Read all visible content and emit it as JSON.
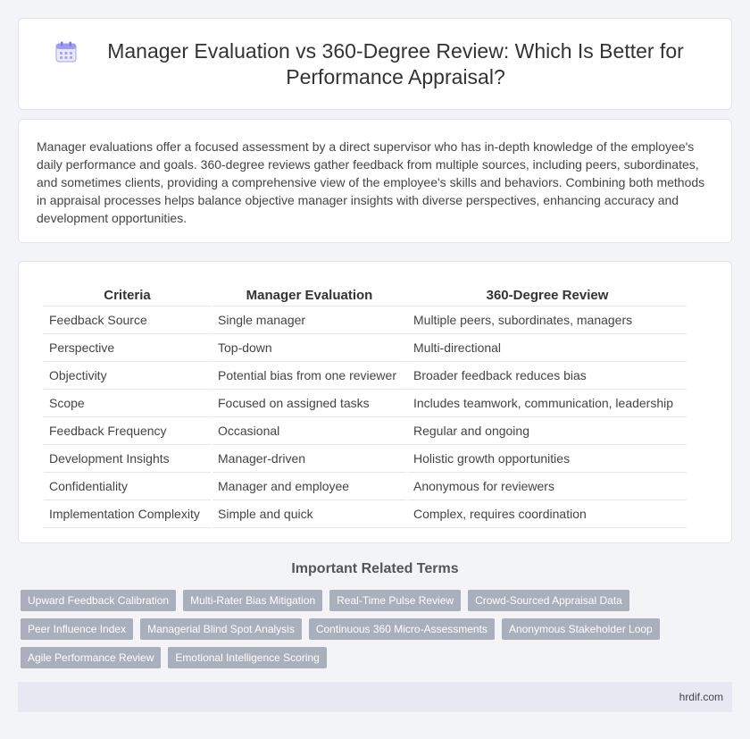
{
  "header": {
    "title": "Manager Evaluation vs 360-Degree Review: Which Is Better for Performance Appraisal?",
    "icon": "calendar-icon",
    "icon_color": "#8f8fe8"
  },
  "intro": {
    "text": "Manager evaluations offer a focused assessment by a direct supervisor who has in-depth knowledge of the employee's daily performance and goals. 360-degree reviews gather feedback from multiple sources, including peers, subordinates, and sometimes clients, providing a comprehensive view of the employee's skills and behaviors. Combining both methods in appraisal processes helps balance objective manager insights with diverse perspectives, enhancing accuracy and development opportunities."
  },
  "table": {
    "headers": [
      "Criteria",
      "Manager Evaluation",
      "360-Degree Review"
    ],
    "rows": [
      [
        "Feedback Source",
        "Single manager",
        "Multiple peers, subordinates, managers"
      ],
      [
        "Perspective",
        "Top-down",
        "Multi-directional"
      ],
      [
        "Objectivity",
        "Potential bias from one reviewer",
        "Broader feedback reduces bias"
      ],
      [
        "Scope",
        "Focused on assigned tasks",
        "Includes teamwork, communication, leadership"
      ],
      [
        "Feedback Frequency",
        "Occasional",
        "Regular and ongoing"
      ],
      [
        "Development Insights",
        "Manager-driven",
        "Holistic growth opportunities"
      ],
      [
        "Confidentiality",
        "Manager and employee",
        "Anonymous for reviewers"
      ],
      [
        "Implementation Complexity",
        "Simple and quick",
        "Complex, requires coordination"
      ]
    ]
  },
  "related": {
    "title": "Important Related Terms",
    "tags": [
      "Upward Feedback Calibration",
      "Multi-Rater Bias Mitigation",
      "Real-Time Pulse Review",
      "Crowd-Sourced Appraisal Data",
      "Peer Influence Index",
      "Managerial Blind Spot Analysis",
      "Continuous 360 Micro-Assessments",
      "Anonymous Stakeholder Loop",
      "Agile Performance Review",
      "Emotional Intelligence Scoring"
    ]
  },
  "footer": {
    "site": "hrdif.com"
  }
}
